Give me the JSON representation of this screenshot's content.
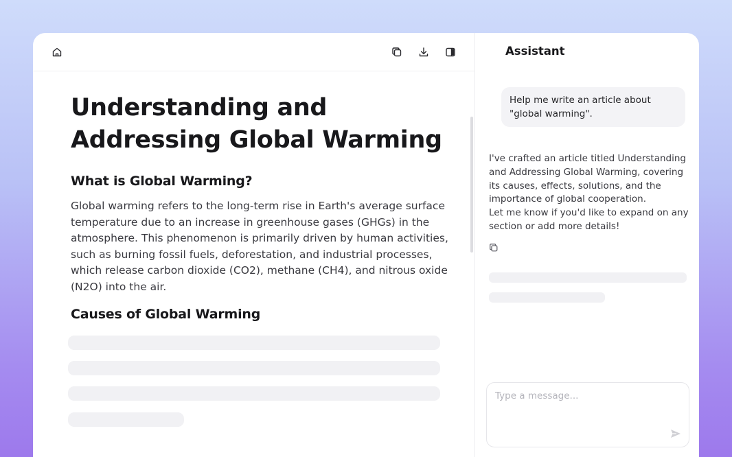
{
  "editor": {
    "toolbar": {
      "home_icon": "home-icon",
      "copy_icon": "copy-icon",
      "download_icon": "download-icon",
      "panel_icon": "panel-toggle-icon"
    },
    "title": "Understanding and Addressing Global Warming",
    "section1_heading": "What is Global Warming?",
    "section1_body": "Global warming refers to the long-term rise in Earth's average surface temperature due to an increase in greenhouse gases (GHGs) in the atmosphere. This phenomenon is primarily driven by human activities, such as burning fossil fuels, deforestation, and industrial processes, which release carbon dioxide (CO2), methane (CH4), and nitrous oxide (N2O) into the air.",
    "section2_heading": "Causes of Global Warming"
  },
  "assistant": {
    "title": "Assistant",
    "user_message": "Help me write an article about \"global warming\".",
    "reply_line1": "I've crafted an article titled Understanding and Addressing Global Warming, covering its causes, effects, solutions, and the importance of global cooperation.",
    "reply_line2": "Let me know if you'd like to expand on any section or add more details!",
    "composer_placeholder": "Type a message..."
  },
  "colors": {
    "accent": "#9d79ec",
    "text": "#18181b",
    "skeleton": "#f1f1f4"
  }
}
